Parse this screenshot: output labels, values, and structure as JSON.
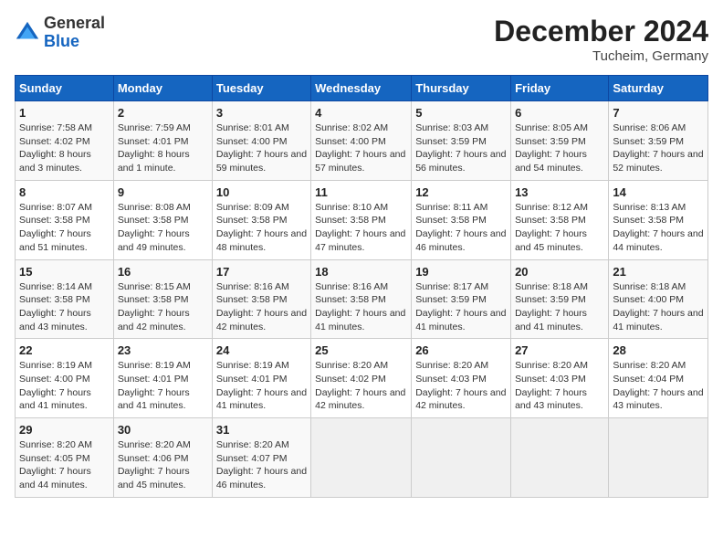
{
  "header": {
    "logo_line1": "General",
    "logo_line2": "Blue",
    "month": "December 2024",
    "location": "Tucheim, Germany"
  },
  "days_of_week": [
    "Sunday",
    "Monday",
    "Tuesday",
    "Wednesday",
    "Thursday",
    "Friday",
    "Saturday"
  ],
  "weeks": [
    [
      {
        "day": "1",
        "info": "Sunrise: 7:58 AM\nSunset: 4:02 PM\nDaylight: 8 hours and 3 minutes."
      },
      {
        "day": "2",
        "info": "Sunrise: 7:59 AM\nSunset: 4:01 PM\nDaylight: 8 hours and 1 minute."
      },
      {
        "day": "3",
        "info": "Sunrise: 8:01 AM\nSunset: 4:00 PM\nDaylight: 7 hours and 59 minutes."
      },
      {
        "day": "4",
        "info": "Sunrise: 8:02 AM\nSunset: 4:00 PM\nDaylight: 7 hours and 57 minutes."
      },
      {
        "day": "5",
        "info": "Sunrise: 8:03 AM\nSunset: 3:59 PM\nDaylight: 7 hours and 56 minutes."
      },
      {
        "day": "6",
        "info": "Sunrise: 8:05 AM\nSunset: 3:59 PM\nDaylight: 7 hours and 54 minutes."
      },
      {
        "day": "7",
        "info": "Sunrise: 8:06 AM\nSunset: 3:59 PM\nDaylight: 7 hours and 52 minutes."
      }
    ],
    [
      {
        "day": "8",
        "info": "Sunrise: 8:07 AM\nSunset: 3:58 PM\nDaylight: 7 hours and 51 minutes."
      },
      {
        "day": "9",
        "info": "Sunrise: 8:08 AM\nSunset: 3:58 PM\nDaylight: 7 hours and 49 minutes."
      },
      {
        "day": "10",
        "info": "Sunrise: 8:09 AM\nSunset: 3:58 PM\nDaylight: 7 hours and 48 minutes."
      },
      {
        "day": "11",
        "info": "Sunrise: 8:10 AM\nSunset: 3:58 PM\nDaylight: 7 hours and 47 minutes."
      },
      {
        "day": "12",
        "info": "Sunrise: 8:11 AM\nSunset: 3:58 PM\nDaylight: 7 hours and 46 minutes."
      },
      {
        "day": "13",
        "info": "Sunrise: 8:12 AM\nSunset: 3:58 PM\nDaylight: 7 hours and 45 minutes."
      },
      {
        "day": "14",
        "info": "Sunrise: 8:13 AM\nSunset: 3:58 PM\nDaylight: 7 hours and 44 minutes."
      }
    ],
    [
      {
        "day": "15",
        "info": "Sunrise: 8:14 AM\nSunset: 3:58 PM\nDaylight: 7 hours and 43 minutes."
      },
      {
        "day": "16",
        "info": "Sunrise: 8:15 AM\nSunset: 3:58 PM\nDaylight: 7 hours and 42 minutes."
      },
      {
        "day": "17",
        "info": "Sunrise: 8:16 AM\nSunset: 3:58 PM\nDaylight: 7 hours and 42 minutes."
      },
      {
        "day": "18",
        "info": "Sunrise: 8:16 AM\nSunset: 3:58 PM\nDaylight: 7 hours and 41 minutes."
      },
      {
        "day": "19",
        "info": "Sunrise: 8:17 AM\nSunset: 3:59 PM\nDaylight: 7 hours and 41 minutes."
      },
      {
        "day": "20",
        "info": "Sunrise: 8:18 AM\nSunset: 3:59 PM\nDaylight: 7 hours and 41 minutes."
      },
      {
        "day": "21",
        "info": "Sunrise: 8:18 AM\nSunset: 4:00 PM\nDaylight: 7 hours and 41 minutes."
      }
    ],
    [
      {
        "day": "22",
        "info": "Sunrise: 8:19 AM\nSunset: 4:00 PM\nDaylight: 7 hours and 41 minutes."
      },
      {
        "day": "23",
        "info": "Sunrise: 8:19 AM\nSunset: 4:01 PM\nDaylight: 7 hours and 41 minutes."
      },
      {
        "day": "24",
        "info": "Sunrise: 8:19 AM\nSunset: 4:01 PM\nDaylight: 7 hours and 41 minutes."
      },
      {
        "day": "25",
        "info": "Sunrise: 8:20 AM\nSunset: 4:02 PM\nDaylight: 7 hours and 42 minutes."
      },
      {
        "day": "26",
        "info": "Sunrise: 8:20 AM\nSunset: 4:03 PM\nDaylight: 7 hours and 42 minutes."
      },
      {
        "day": "27",
        "info": "Sunrise: 8:20 AM\nSunset: 4:03 PM\nDaylight: 7 hours and 43 minutes."
      },
      {
        "day": "28",
        "info": "Sunrise: 8:20 AM\nSunset: 4:04 PM\nDaylight: 7 hours and 43 minutes."
      }
    ],
    [
      {
        "day": "29",
        "info": "Sunrise: 8:20 AM\nSunset: 4:05 PM\nDaylight: 7 hours and 44 minutes."
      },
      {
        "day": "30",
        "info": "Sunrise: 8:20 AM\nSunset: 4:06 PM\nDaylight: 7 hours and 45 minutes."
      },
      {
        "day": "31",
        "info": "Sunrise: 8:20 AM\nSunset: 4:07 PM\nDaylight: 7 hours and 46 minutes."
      },
      null,
      null,
      null,
      null
    ]
  ]
}
